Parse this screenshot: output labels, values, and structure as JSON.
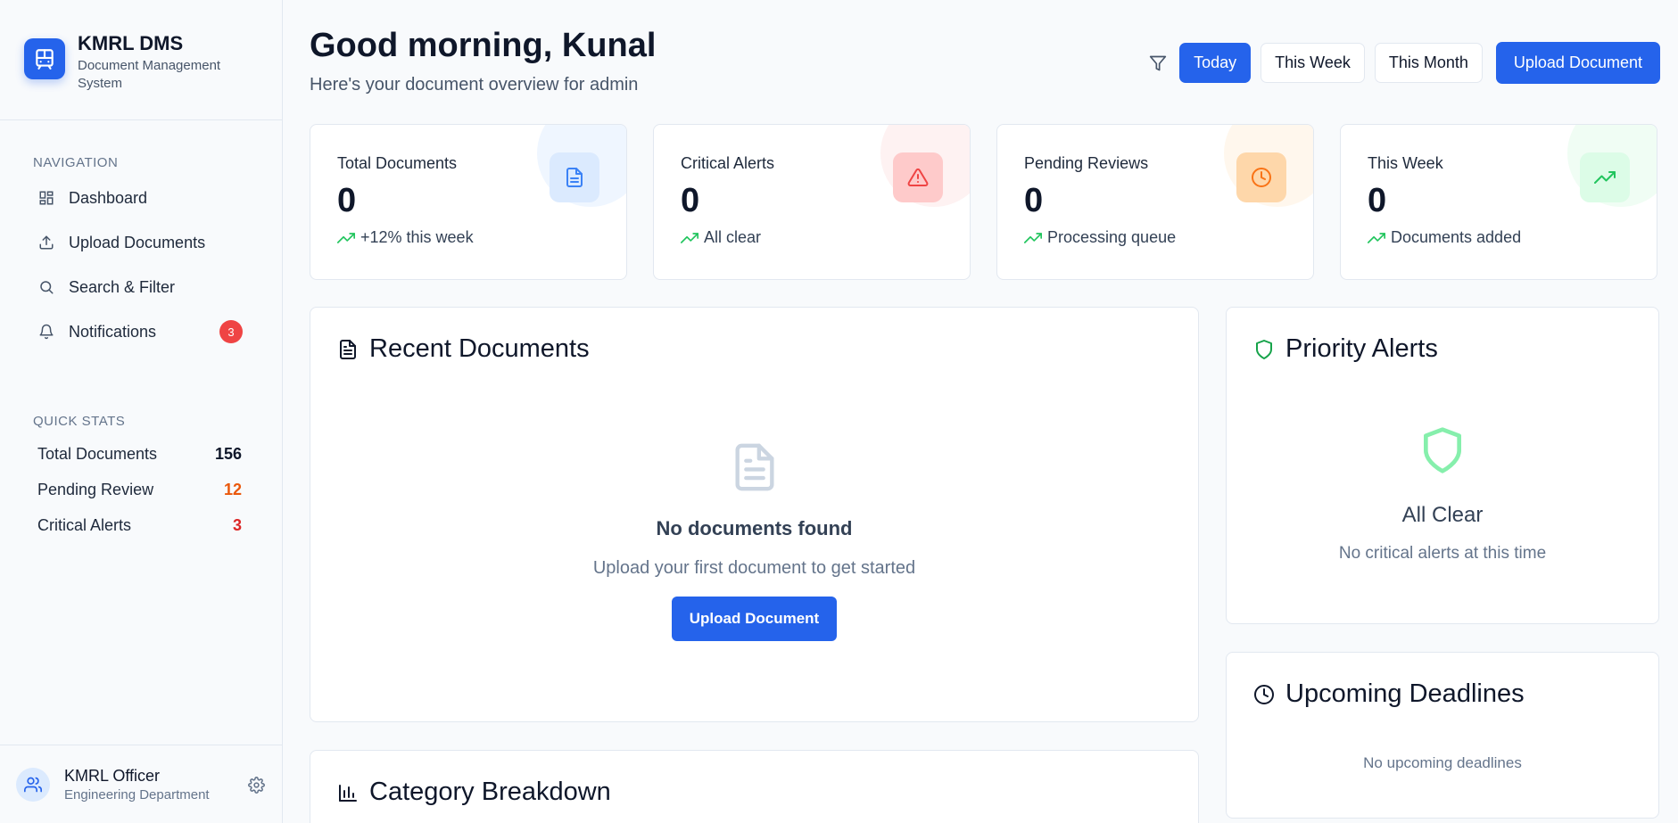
{
  "app": {
    "title": "KMRL DMS",
    "subtitle": "Document Management System"
  },
  "nav": {
    "section_label": "NAVIGATION",
    "items": [
      {
        "label": "Dashboard",
        "icon": "dashboard-icon"
      },
      {
        "label": "Upload Documents",
        "icon": "upload-icon"
      },
      {
        "label": "Search & Filter",
        "icon": "search-icon"
      },
      {
        "label": "Notifications",
        "icon": "bell-icon",
        "badge": "3"
      }
    ]
  },
  "quick_stats": {
    "section_label": "QUICK STATS",
    "rows": [
      {
        "label": "Total Documents",
        "value": "156",
        "color": "#0f172a"
      },
      {
        "label": "Pending Review",
        "value": "12",
        "color": "#ea580c"
      },
      {
        "label": "Critical Alerts",
        "value": "3",
        "color": "#dc2626"
      }
    ]
  },
  "user": {
    "name": "KMRL Officer",
    "department": "Engineering Department"
  },
  "header": {
    "greeting": "Good morning, Kunal",
    "subtitle": "Here's your document overview for admin"
  },
  "filters": {
    "options": [
      "Today",
      "This Week",
      "This Month"
    ],
    "active": "Today",
    "upload_label": "Upload Document"
  },
  "stats": [
    {
      "label": "Total Documents",
      "value": "0",
      "trend": "+12% this week",
      "icon": "document-icon",
      "accent": "#3b82f6",
      "bg": "#dbeafe",
      "blob": "#eff6ff"
    },
    {
      "label": "Critical Alerts",
      "value": "0",
      "trend": "All clear",
      "icon": "warning-icon",
      "accent": "#ef4444",
      "bg": "#fecaca",
      "blob": "#fef2f2"
    },
    {
      "label": "Pending Reviews",
      "value": "0",
      "trend": "Processing queue",
      "icon": "clock-icon",
      "accent": "#f97316",
      "bg": "#fed7aa",
      "blob": "#fff7ed"
    },
    {
      "label": "This Week",
      "value": "0",
      "trend": "Documents added",
      "icon": "trending-up-icon",
      "accent": "#22c55e",
      "bg": "#dcfce7",
      "blob": "#f0fdf4"
    }
  ],
  "recent": {
    "title": "Recent Documents",
    "empty_title": "No documents found",
    "empty_sub": "Upload your first document to get started",
    "button_label": "Upload Document"
  },
  "category": {
    "title": "Category Breakdown"
  },
  "priority": {
    "title": "Priority Alerts",
    "empty_title": "All Clear",
    "empty_sub": "No critical alerts at this time"
  },
  "deadlines": {
    "title": "Upcoming Deadlines",
    "empty": "No upcoming deadlines"
  },
  "colors": {
    "primary": "#2563eb",
    "trend_green": "#22c55e"
  }
}
